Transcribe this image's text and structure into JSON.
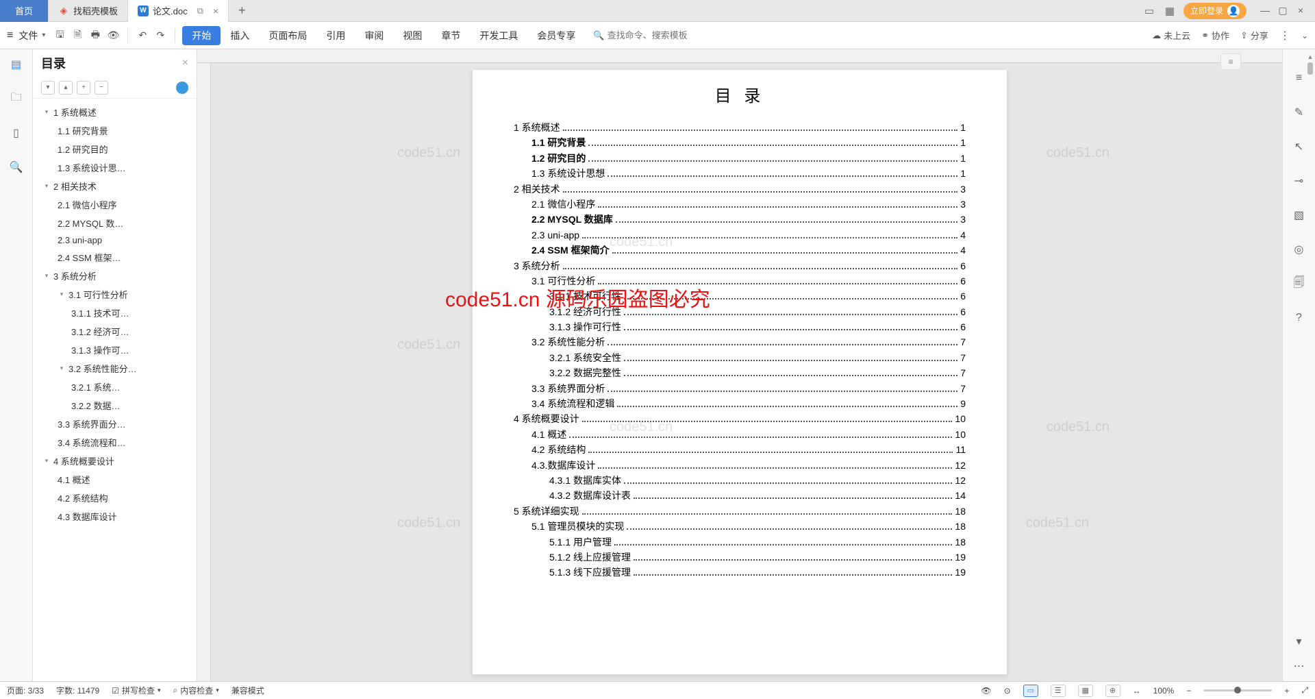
{
  "tabs": {
    "home": "首页",
    "template_tab": "找稻壳模板",
    "doc_tab": "论文.doc",
    "plus": "+"
  },
  "topbar": {
    "login": "立即登录"
  },
  "toolbar": {
    "file": "文件",
    "menu": [
      "开始",
      "插入",
      "页面布局",
      "引用",
      "审阅",
      "视图",
      "章节",
      "开发工具",
      "会员专享"
    ],
    "active_index": 0,
    "search_placeholder": "查找命令、搜索模板",
    "not_cloud": "未上云",
    "collab": "协作",
    "share": "分享"
  },
  "outline": {
    "title": "目录",
    "items": [
      {
        "lvl": 1,
        "chevron": "▾",
        "text": "1 系统概述"
      },
      {
        "lvl": 2,
        "text": "1.1 研究背景"
      },
      {
        "lvl": 2,
        "text": "1.2 研究目的"
      },
      {
        "lvl": 2,
        "text": "1.3 系统设计思…"
      },
      {
        "lvl": 1,
        "chevron": "▾",
        "text": "2 相关技术"
      },
      {
        "lvl": 2,
        "text": "2.1 微信小程序"
      },
      {
        "lvl": 2,
        "text": "2.2 MYSQL 数…"
      },
      {
        "lvl": 2,
        "text": "2.3 uni-app"
      },
      {
        "lvl": 2,
        "text": "2.4 SSM 框架…"
      },
      {
        "lvl": 1,
        "chevron": "▾",
        "text": "3 系统分析"
      },
      {
        "lvl": 2,
        "chevron": "▾",
        "text": "3.1 可行性分析"
      },
      {
        "lvl": 3,
        "text": "3.1.1 技术可…"
      },
      {
        "lvl": 3,
        "text": "3.1.2 经济可…"
      },
      {
        "lvl": 3,
        "text": "3.1.3 操作可…"
      },
      {
        "lvl": 2,
        "chevron": "▾",
        "text": "3.2 系统性能分…"
      },
      {
        "lvl": 3,
        "text": "3.2.1  系统…"
      },
      {
        "lvl": 3,
        "text": "3.2.2  数据…"
      },
      {
        "lvl": 2,
        "text": "3.3 系统界面分…"
      },
      {
        "lvl": 2,
        "text": "3.4 系统流程和…"
      },
      {
        "lvl": 1,
        "chevron": "▾",
        "text": "4 系统概要设计"
      },
      {
        "lvl": 2,
        "text": "4.1 概述"
      },
      {
        "lvl": 2,
        "text": "4.2 系统结构"
      },
      {
        "lvl": 2,
        "text": "4.3 数据库设计"
      }
    ]
  },
  "document": {
    "title": "目 录",
    "toc": [
      {
        "lvl": 1,
        "label": "1 系统概述",
        "page": "1"
      },
      {
        "lvl": 2,
        "bold": true,
        "label": "1.1 研究背景",
        "page": "1"
      },
      {
        "lvl": 2,
        "bold": true,
        "label": "1.2 研究目的",
        "page": "1"
      },
      {
        "lvl": 2,
        "label": "1.3 系统设计思想",
        "page": "1"
      },
      {
        "lvl": 1,
        "label": "2 相关技术",
        "page": "3"
      },
      {
        "lvl": 2,
        "label": "2.1 微信小程序",
        "page": "3"
      },
      {
        "lvl": 2,
        "bold": true,
        "label": "2.2 MYSQL 数据库",
        "page": "3"
      },
      {
        "lvl": 2,
        "label": "2.3 uni-app",
        "page": "4"
      },
      {
        "lvl": 2,
        "bold": true,
        "label": "2.4 SSM 框架简介",
        "page": "4"
      },
      {
        "lvl": 1,
        "label": "3 系统分析",
        "page": "6"
      },
      {
        "lvl": 2,
        "label": "3.1 可行性分析",
        "page": "6"
      },
      {
        "lvl": 3,
        "label": "3.1.1 技术可行性",
        "page": "6"
      },
      {
        "lvl": 3,
        "label": "3.1.2 经济可行性",
        "page": "6"
      },
      {
        "lvl": 3,
        "label": "3.1.3 操作可行性",
        "page": "6"
      },
      {
        "lvl": 2,
        "label": "3.2 系统性能分析",
        "page": "7"
      },
      {
        "lvl": 3,
        "label": "3.2.1 系统安全性",
        "page": "7"
      },
      {
        "lvl": 3,
        "label": "3.2.2 数据完整性",
        "page": "7"
      },
      {
        "lvl": 2,
        "label": "3.3 系统界面分析",
        "page": "7"
      },
      {
        "lvl": 2,
        "label": "3.4 系统流程和逻辑",
        "page": "9"
      },
      {
        "lvl": 1,
        "label": "4 系统概要设计",
        "page": "10"
      },
      {
        "lvl": 2,
        "label": "4.1 概述",
        "page": "10"
      },
      {
        "lvl": 2,
        "label": "4.2 系统结构",
        "page": "11"
      },
      {
        "lvl": 2,
        "label": "4.3.数据库设计",
        "page": "12"
      },
      {
        "lvl": 3,
        "label": "4.3.1 数据库实体",
        "page": "12"
      },
      {
        "lvl": 3,
        "label": "4.3.2 数据库设计表",
        "page": "14"
      },
      {
        "lvl": 1,
        "label": "5 系统详细实现",
        "page": "18"
      },
      {
        "lvl": 2,
        "label": "5.1 管理员模块的实现",
        "page": "18"
      },
      {
        "lvl": 3,
        "label": "5.1.1 用户管理",
        "page": "18"
      },
      {
        "lvl": 3,
        "label": "5.1.2 线上应援管理",
        "page": "19"
      },
      {
        "lvl": 3,
        "label": "5.1.3 线下应援管理",
        "page": "19"
      }
    ],
    "watermarks": [
      "code51.cn"
    ],
    "red_mark": "code51.cn   源码乐园盗图必究"
  },
  "status": {
    "page": "页面: 3/33",
    "words": "字数: 11479",
    "spell": "拼写检查",
    "content": "内容检查",
    "compat": "兼容模式",
    "zoom": "100%"
  }
}
